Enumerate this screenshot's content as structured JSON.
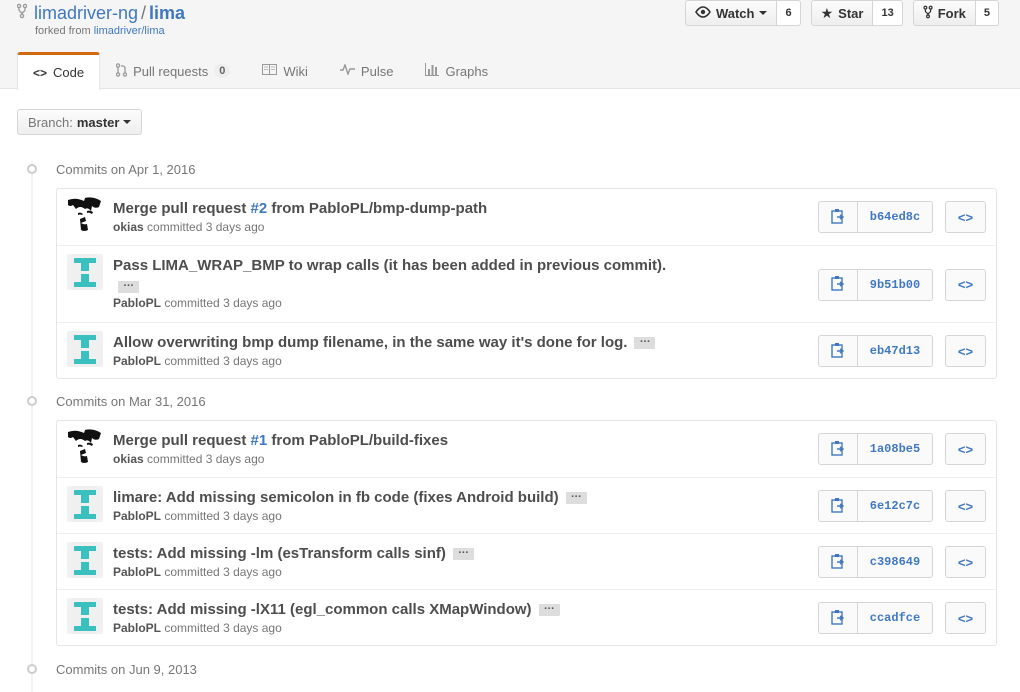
{
  "repo": {
    "owner": "limadriver-ng",
    "separator": "/",
    "name": "lima",
    "forked_from_prefix": "forked from",
    "forked_from": "limadriver/lima"
  },
  "actions": {
    "watch_label": "Watch",
    "watch_count": "6",
    "star_label": "Star",
    "star_count": "13",
    "fork_label": "Fork",
    "fork_count": "5"
  },
  "tabs": [
    {
      "label": "Code",
      "icon": "code-icon"
    },
    {
      "label": "Pull requests",
      "count": "0",
      "icon": "pull-request-icon"
    },
    {
      "label": "Wiki",
      "icon": "book-icon"
    },
    {
      "label": "Pulse",
      "icon": "pulse-icon"
    },
    {
      "label": "Graphs",
      "icon": "graph-icon"
    }
  ],
  "branch": {
    "label": "Branch:",
    "value": "master"
  },
  "groups": [
    {
      "title": "Commits on Apr 1, 2016",
      "commits": [
        {
          "pre": "Merge pull request ",
          "issue": "#2",
          "post": " from PabloPL/bmp-dump-path",
          "author": "okias",
          "verb": "committed",
          "time": "3 days ago",
          "sha": "b64ed8c",
          "avatar": "face"
        },
        {
          "pre": "Pass LIMA_WRAP_BMP to wrap calls (it has been added in previous commit).",
          "issue": "",
          "post": "",
          "author": "PabloPL",
          "verb": "committed",
          "time": "3 days ago",
          "sha": "9b51b00",
          "avatar": "identicon"
        },
        {
          "pre": "Allow overwriting bmp dump filename, in the same way it's done for log.",
          "issue": "",
          "post": "",
          "author": "PabloPL",
          "verb": "committed",
          "time": "3 days ago",
          "sha": "eb47d13",
          "avatar": "identicon"
        }
      ]
    },
    {
      "title": "Commits on Mar 31, 2016",
      "commits": [
        {
          "pre": "Merge pull request ",
          "issue": "#1",
          "post": " from PabloPL/build-fixes",
          "author": "okias",
          "verb": "committed",
          "time": "3 days ago",
          "sha": "1a08be5",
          "avatar": "face"
        },
        {
          "pre": "limare: Add missing semicolon in fb code (fixes Android build)",
          "issue": "",
          "post": "",
          "author": "PabloPL",
          "verb": "committed",
          "time": "3 days ago",
          "sha": "6e12c7c",
          "avatar": "identicon"
        },
        {
          "pre": "tests: Add missing -lm (esTransform calls sinf)",
          "issue": "",
          "post": "",
          "author": "PabloPL",
          "verb": "committed",
          "time": "3 days ago",
          "sha": "c398649",
          "avatar": "identicon"
        },
        {
          "pre": "tests: Add missing -lX11 (egl_common calls XMapWindow)",
          "issue": "",
          "post": "",
          "author": "PabloPL",
          "verb": "committed",
          "time": "3 days ago",
          "sha": "ccadfce",
          "avatar": "identicon"
        }
      ]
    },
    {
      "title": "Commits on Jun 9, 2013",
      "commits": []
    }
  ],
  "expand_glyph": "…",
  "browse_glyph": "<>",
  "colors": {
    "link": "#4078c0",
    "tab_accent": "#d26911",
    "identicon": "#3bc0c0"
  }
}
